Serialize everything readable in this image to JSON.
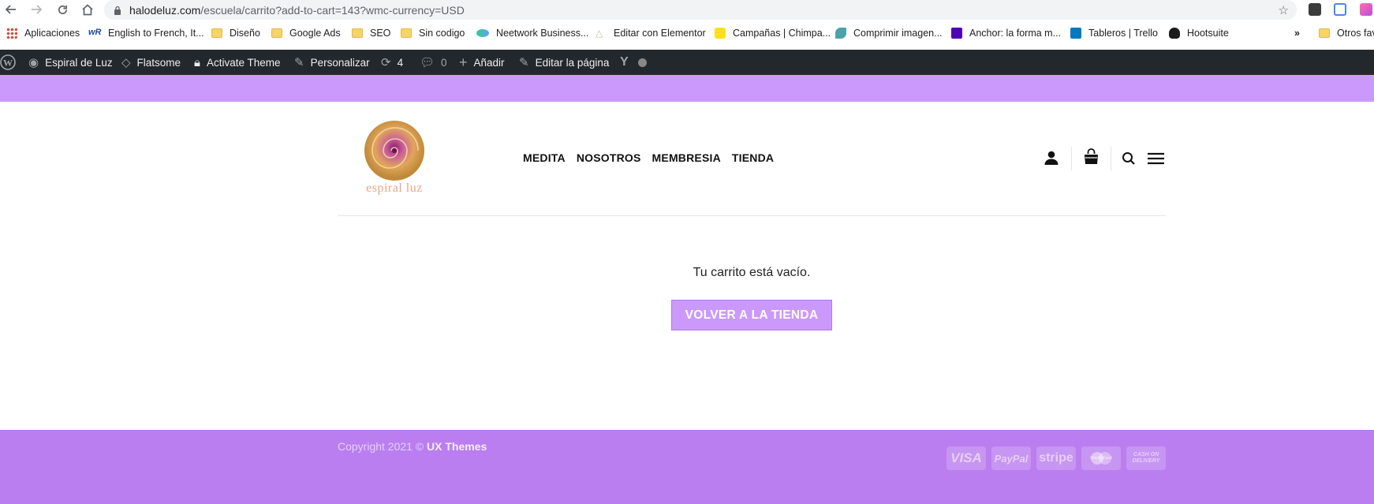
{
  "browser": {
    "url_host": "halodeluz.com",
    "url_path": "/escuela/carrito?add-to-cart=143?wmc-currency=USD",
    "bookmarks": [
      {
        "label": "Aplicaciones",
        "icon": "apps-grid-icon"
      },
      {
        "label": "English to French, It...",
        "icon": "wordreference-icon"
      },
      {
        "label": "Diseño",
        "icon": "folder-icon"
      },
      {
        "label": "Google Ads",
        "icon": "folder-icon"
      },
      {
        "label": "SEO",
        "icon": "folder-icon"
      },
      {
        "label": "Sin codigo",
        "icon": "folder-icon"
      },
      {
        "label": "Neetwork Business...",
        "icon": "neetwork-icon"
      },
      {
        "label": "Editar con Elementor",
        "icon": "elementor-icon"
      },
      {
        "label": "Campañas | Chimpa...",
        "icon": "mailchimp-icon"
      },
      {
        "label": "Comprimir imagen...",
        "icon": "compress-icon"
      },
      {
        "label": "Anchor: la forma m...",
        "icon": "anchor-icon"
      },
      {
        "label": "Tableros | Trello",
        "icon": "trello-icon"
      },
      {
        "label": "Hootsuite",
        "icon": "hootsuite-icon"
      },
      {
        "label": "»",
        "icon": "more-chevron-icon"
      },
      {
        "label": "Otros fav",
        "icon": "folder-icon"
      }
    ]
  },
  "wp_admin": {
    "site_name": "Espiral de Luz",
    "theme": "Flatsome",
    "activate": "Activate Theme",
    "customize": "Personalizar",
    "updates_count": "4",
    "comments_count": "0",
    "add_new": "Añadir",
    "edit_page": "Editar la página"
  },
  "header": {
    "logo_text": "espiral luz",
    "nav": [
      "MEDITA",
      "NOSOTROS",
      "MEMBRESIA",
      "TIENDA"
    ]
  },
  "cart": {
    "empty_message": "Tu carrito está vacío.",
    "return_button": "VOLVER A LA TIENDA"
  },
  "footer": {
    "copyright_prefix": "Copyright 2021 ©",
    "copyright_brand": "UX Themes",
    "payment_methods": [
      "VISA",
      "PayPal",
      "stripe",
      "MasterCard",
      "CASH ON DELIVERY"
    ]
  },
  "colors": {
    "accent": "#cb99fb",
    "footer": "#bb7ef0",
    "admin_bar": "#23282d"
  }
}
